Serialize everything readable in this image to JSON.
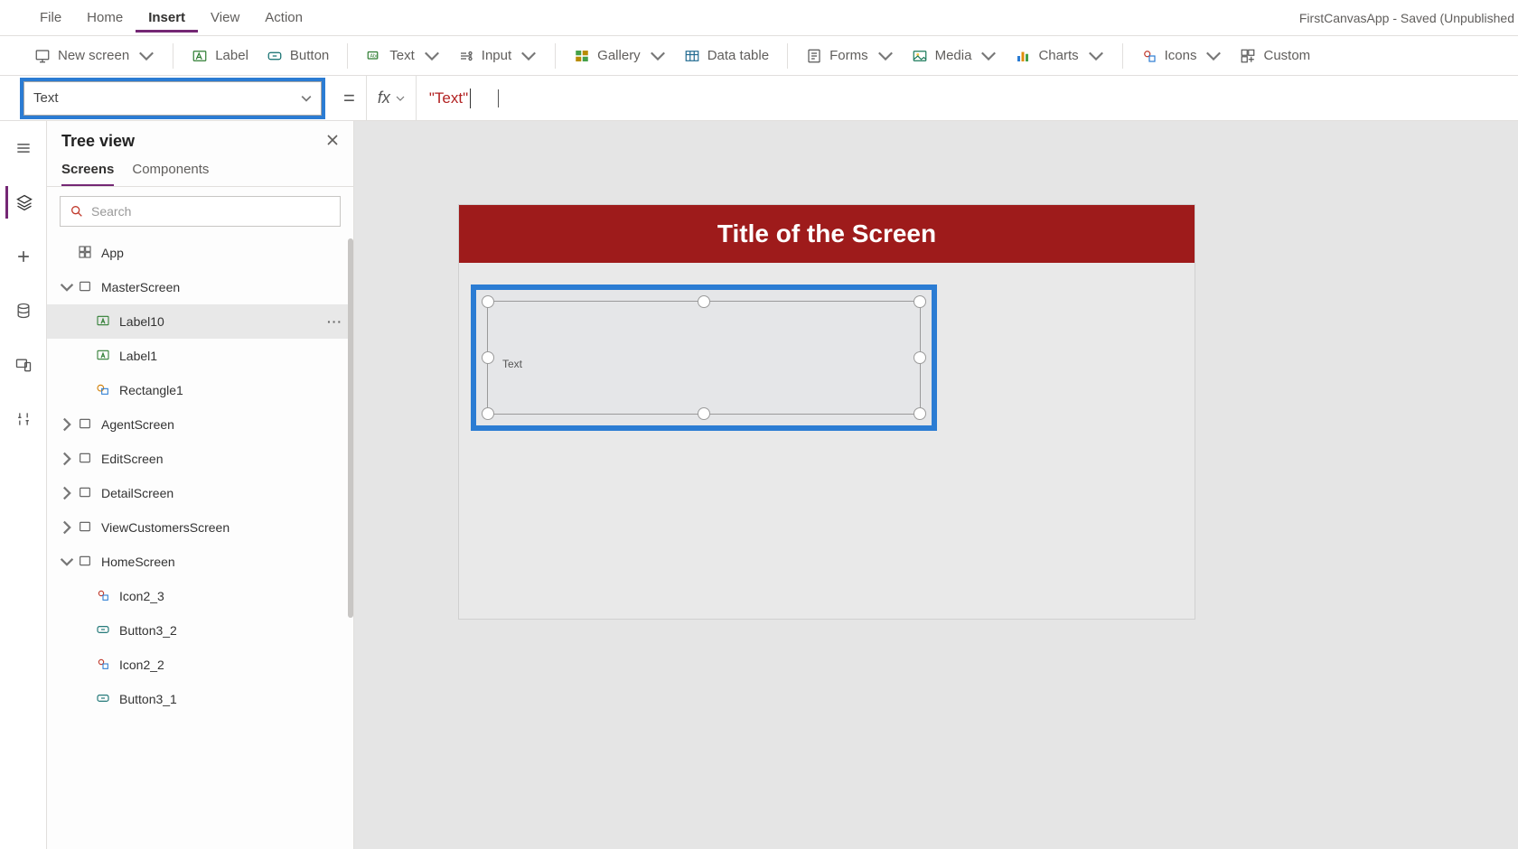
{
  "menubar": {
    "items": [
      "File",
      "Home",
      "Insert",
      "View",
      "Action"
    ],
    "active_index": 2,
    "app_title": "FirstCanvasApp - Saved (Unpublished"
  },
  "ribbon": {
    "new_screen": "New screen",
    "label": "Label",
    "button": "Button",
    "text": "Text",
    "input": "Input",
    "gallery": "Gallery",
    "data_table": "Data table",
    "forms": "Forms",
    "media": "Media",
    "charts": "Charts",
    "icons": "Icons",
    "custom": "Custom"
  },
  "formula": {
    "property": "Text",
    "equals": "=",
    "fx": "fx",
    "value": "\"Text\""
  },
  "tree": {
    "title": "Tree view",
    "tabs": {
      "screens": "Screens",
      "components": "Components"
    },
    "search_placeholder": "Search",
    "items": [
      {
        "kind": "app",
        "label": "App",
        "indent": 0,
        "chev": null
      },
      {
        "kind": "screen",
        "label": "MasterScreen",
        "indent": 0,
        "chev": "down",
        "expanded": true
      },
      {
        "kind": "label",
        "label": "Label10",
        "indent": 2,
        "selected": true,
        "more": true
      },
      {
        "kind": "label",
        "label": "Label1",
        "indent": 2
      },
      {
        "kind": "shape",
        "label": "Rectangle1",
        "indent": 2
      },
      {
        "kind": "screen",
        "label": "AgentScreen",
        "indent": 0,
        "chev": "right"
      },
      {
        "kind": "screen",
        "label": "EditScreen",
        "indent": 0,
        "chev": "right"
      },
      {
        "kind": "screen",
        "label": "DetailScreen",
        "indent": 0,
        "chev": "right"
      },
      {
        "kind": "screen",
        "label": "ViewCustomersScreen",
        "indent": 0,
        "chev": "right"
      },
      {
        "kind": "screen",
        "label": "HomeScreen",
        "indent": 0,
        "chev": "down",
        "expanded": true
      },
      {
        "kind": "icon",
        "label": "Icon2_3",
        "indent": 2
      },
      {
        "kind": "button",
        "label": "Button3_2",
        "indent": 2
      },
      {
        "kind": "icon",
        "label": "Icon2_2",
        "indent": 2
      },
      {
        "kind": "button",
        "label": "Button3_1",
        "indent": 2
      }
    ]
  },
  "canvas": {
    "title": "Title of the Screen",
    "selected_label_text": "Text"
  }
}
